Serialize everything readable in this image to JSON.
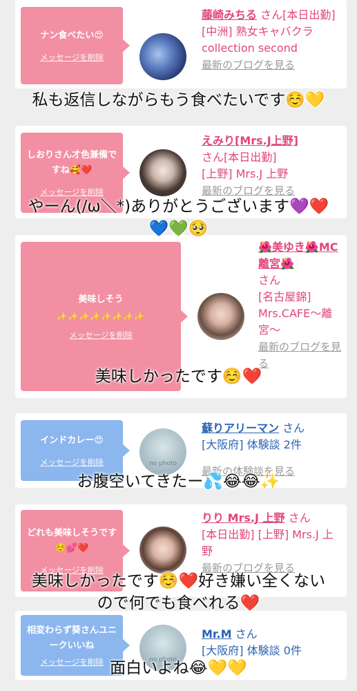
{
  "cards": [
    {
      "message": "ナン食べたい😍",
      "delete_label": "メッセージを削除",
      "name": "藤崎みちる",
      "san": "さん[本日出勤]",
      "detail": "[中洲] 熟女キャバクラ collection second",
      "blog": "最新のブログを見る",
      "avatar": "blue-rose-photo",
      "bubble_color": "#f28fa3"
    },
    {
      "message": "しおりさん才色兼備ですね🥰❤️",
      "delete_label": "メッセージを削除",
      "name": "えみり[Mrs.J上野]",
      "san": "さん[本日出勤]",
      "detail": "[上野] Mrs.J 上野",
      "blog": "最新のブログを見る",
      "avatar": "woman-photo",
      "bubble_color": "#f28fa3"
    },
    {
      "message": "美味しそう",
      "sparkles": "✨✨✨✨✨✨✨✨",
      "delete_label": "メッセージを削除",
      "name": "🌺美ゆき🌺MC離宮🌺",
      "san": "さん",
      "detail": "[名古屋錦] Mrs.CAFE～離宮～",
      "blog": "最新のブログを見る",
      "avatar": "woman-photo",
      "bubble_color": "#f28fa3"
    },
    {
      "message": "インドカレー😍",
      "delete_label": "メッセージを削除",
      "name": "蘇りアリーマン",
      "san": "さん",
      "detail": "[大阪府] 体験談 2件",
      "blog": "最新の体験談を見る",
      "avatar_text": "no photo",
      "bubble_color": "#8cb6ee"
    },
    {
      "message": "どれも美味しそうです☺️💕❤️",
      "delete_label": "メッセージを削除",
      "name": "りり Mrs.J 上野",
      "san": "さん",
      "detail": "[本日出勤] [上野] Mrs.J 上野",
      "blog": "最新のブログを見る",
      "avatar": "woman-photo",
      "bubble_color": "#f28fa3"
    },
    {
      "message": "相変わらず葵さんユニークいいね",
      "delete_label": "メッセージを削除",
      "name": "Mr.M",
      "san": "さん",
      "detail": "[大阪府] 体験談 0件",
      "avatar_text": "no photo",
      "bubble_color": "#8cb6ee"
    }
  ],
  "overlays": [
    "私も返信しながらもう食べたいです☺️💛",
    "やーん(/ω＼*)ありがとうございます💜❤️",
    "💙💚🥺",
    "美味しかったです☺️❤️",
    "お腹空いてきたー💦😂😂✨",
    "美味しかったです☺️❤️好き嫌い全くない",
    "ので何でも食べれる❤️",
    "面白いよね😂💛💛"
  ]
}
